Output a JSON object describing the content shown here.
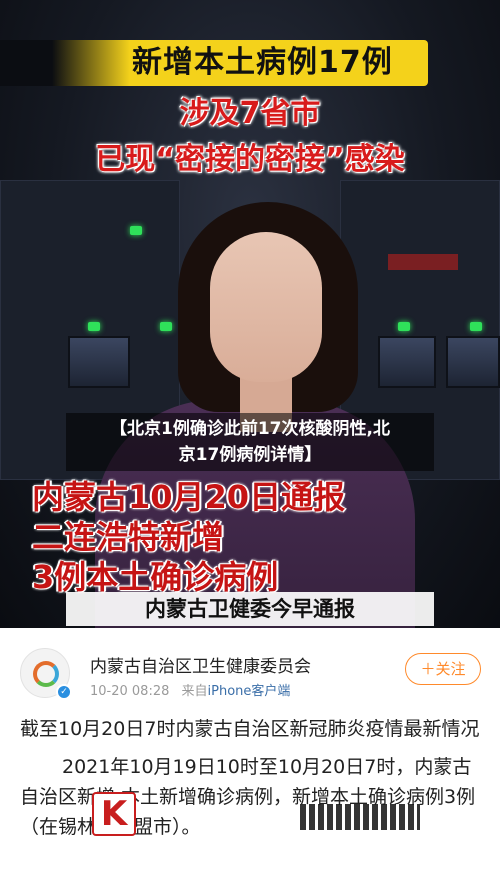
{
  "video": {
    "headline": "新增本土病例17例",
    "subline_1": "涉及7省市",
    "subline_2": "已现“密接的密接”感染",
    "overlay_title_line1": "【北京1例确诊此前17次核酸阴性,北",
    "overlay_title_line2": "京17例病例详情】",
    "notice_line_1": "内蒙古10月20日通报",
    "notice_line_2": "二连浩特新增",
    "notice_line_3": "3例本土确诊病例",
    "caption": "内蒙古卫健委今早通报"
  },
  "post": {
    "author": "内蒙古自治区卫生健康委员会",
    "time": "10-20 08:28",
    "source_prefix": "来自",
    "source": "iPhone客户端",
    "follow_label": "＋关注",
    "paragraph_1": "截至10月20日7时内蒙古自治区新冠肺炎疫情最新情况",
    "paragraph_2": "2021年10月19日10时至10月20日7时，内蒙古自治区新增 本土新增确诊病例，新增本土确诊病例3例（在锡林郭勒盟市）。"
  },
  "watermark": {
    "glyph": "K",
    "color": "#c81e1e"
  },
  "colors": {
    "headline_bg": "#f4d21b",
    "alert_red": "#c61414",
    "follow_orange": "#ff8a2b"
  }
}
